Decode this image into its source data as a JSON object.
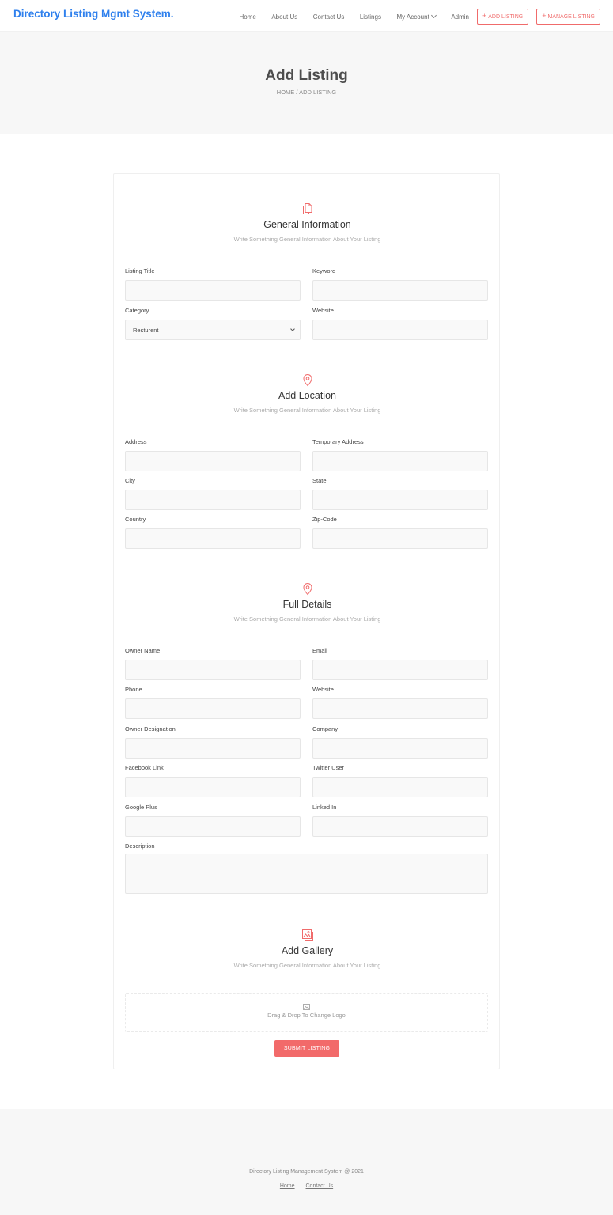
{
  "header": {
    "brand": "Directory Listing Mgmt System.",
    "nav": [
      "Home",
      "About Us",
      "Contact Us",
      "Listings",
      "My Account",
      "Admin"
    ],
    "add_listing_btn": "ADD LISTING",
    "manage_listing_btn": "MANAGE LISTING"
  },
  "hero": {
    "title": "Add Listing",
    "breadcrumb": "HOME / ADD LISTING"
  },
  "general": {
    "title": "General Information",
    "subtitle": "Write Something General Information About Your Listing",
    "listing_title_label": "Listing Title",
    "keyword_label": "Keyword",
    "category_label": "Category",
    "category_value": "Resturent",
    "website_label": "Website"
  },
  "location": {
    "title": "Add Location",
    "subtitle": "Write Something General Information About Your Listing",
    "address_label": "Address",
    "temp_address_label": "Temporary Address",
    "city_label": "City",
    "state_label": "State",
    "country_label": "Country",
    "zip_label": "Zip-Code"
  },
  "details": {
    "title": "Full Details",
    "subtitle": "Write Something General Information About Your Listing",
    "owner_name_label": "Owner Name",
    "email_label": "Email",
    "phone_label": "Phone",
    "website_label": "Website",
    "owner_designation_label": "Owner Designation",
    "company_label": "Company",
    "facebook_label": "Facebook Link",
    "twitter_label": "Twitter User",
    "google_label": "Google Plus",
    "linkedin_label": "Linked In",
    "description_label": "Description"
  },
  "gallery": {
    "title": "Add Gallery",
    "subtitle": "Write Something General Information About Your Listing",
    "dropzone_text": "Drag & Drop To Change Logo",
    "submit_label": "SUBMIT LISTING"
  },
  "footer": {
    "copyright": "Directory Listing Management System @ 2021",
    "links": [
      "Home",
      "Contact Us"
    ]
  },
  "colors": {
    "brand": "#2f80ed",
    "accent": "#f26a6a"
  },
  "icons": {
    "general": "documents-icon",
    "location": "map-pin-icon",
    "details": "map-pin-icon",
    "gallery": "image-gallery-icon"
  }
}
